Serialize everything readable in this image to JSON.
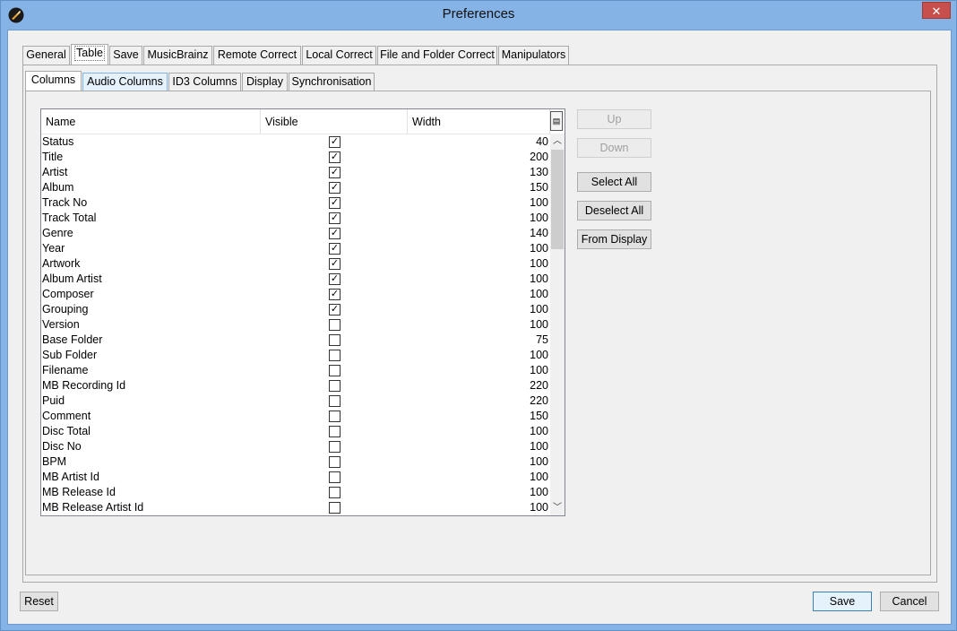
{
  "window": {
    "title": "Preferences",
    "close_label": "✕"
  },
  "top_tabs": [
    {
      "label": "General"
    },
    {
      "label": "Table"
    },
    {
      "label": "Save"
    },
    {
      "label": "MusicBrainz"
    },
    {
      "label": "Remote Correct"
    },
    {
      "label": "Local Correct"
    },
    {
      "label": "File and Folder Correct"
    },
    {
      "label": "Manipulators"
    }
  ],
  "sub_tabs": [
    {
      "label": "Columns"
    },
    {
      "label": "Audio Columns"
    },
    {
      "label": "ID3 Columns"
    },
    {
      "label": "Display"
    },
    {
      "label": "Synchronisation"
    }
  ],
  "table": {
    "headers": {
      "name": "Name",
      "visible": "Visible",
      "width": "Width"
    },
    "rows": [
      {
        "name": "Status",
        "visible": true,
        "width": "40"
      },
      {
        "name": "Title",
        "visible": true,
        "width": "200"
      },
      {
        "name": "Artist",
        "visible": true,
        "width": "130"
      },
      {
        "name": "Album",
        "visible": true,
        "width": "150"
      },
      {
        "name": "Track No",
        "visible": true,
        "width": "100"
      },
      {
        "name": "Track Total",
        "visible": true,
        "width": "100"
      },
      {
        "name": "Genre",
        "visible": true,
        "width": "140"
      },
      {
        "name": "Year",
        "visible": true,
        "width": "100"
      },
      {
        "name": "Artwork",
        "visible": true,
        "width": "100"
      },
      {
        "name": "Album Artist",
        "visible": true,
        "width": "100"
      },
      {
        "name": "Composer",
        "visible": true,
        "width": "100"
      },
      {
        "name": "Grouping",
        "visible": true,
        "width": "100"
      },
      {
        "name": "Version",
        "visible": false,
        "width": "100"
      },
      {
        "name": "Base Folder",
        "visible": false,
        "width": "75"
      },
      {
        "name": "Sub Folder",
        "visible": false,
        "width": "100"
      },
      {
        "name": "Filename",
        "visible": false,
        "width": "100"
      },
      {
        "name": "MB Recording Id",
        "visible": false,
        "width": "220"
      },
      {
        "name": "Puid",
        "visible": false,
        "width": "220"
      },
      {
        "name": "Comment",
        "visible": false,
        "width": "150"
      },
      {
        "name": "Disc Total",
        "visible": false,
        "width": "100"
      },
      {
        "name": "Disc No",
        "visible": false,
        "width": "100"
      },
      {
        "name": "BPM",
        "visible": false,
        "width": "100"
      },
      {
        "name": "MB Artist Id",
        "visible": false,
        "width": "100"
      },
      {
        "name": "MB Release Id",
        "visible": false,
        "width": "100"
      },
      {
        "name": "MB Release Artist Id",
        "visible": false,
        "width": "100"
      }
    ]
  },
  "side_buttons": {
    "up": "Up",
    "down": "Down",
    "select_all": "Select All",
    "deselect_all": "Deselect All",
    "from_display": "From Display"
  },
  "footer": {
    "reset": "Reset",
    "save": "Save",
    "cancel": "Cancel"
  },
  "icons": {
    "app": "app-icon",
    "column_chooser": "column-chooser-icon",
    "scroll_up": "scroll-up-arrow-icon",
    "scroll_down": "scroll-down-arrow-icon"
  },
  "colors": {
    "titlebar": "#85b3e6",
    "close": "#c7504c",
    "dialog_bg": "#f0f0f0"
  }
}
